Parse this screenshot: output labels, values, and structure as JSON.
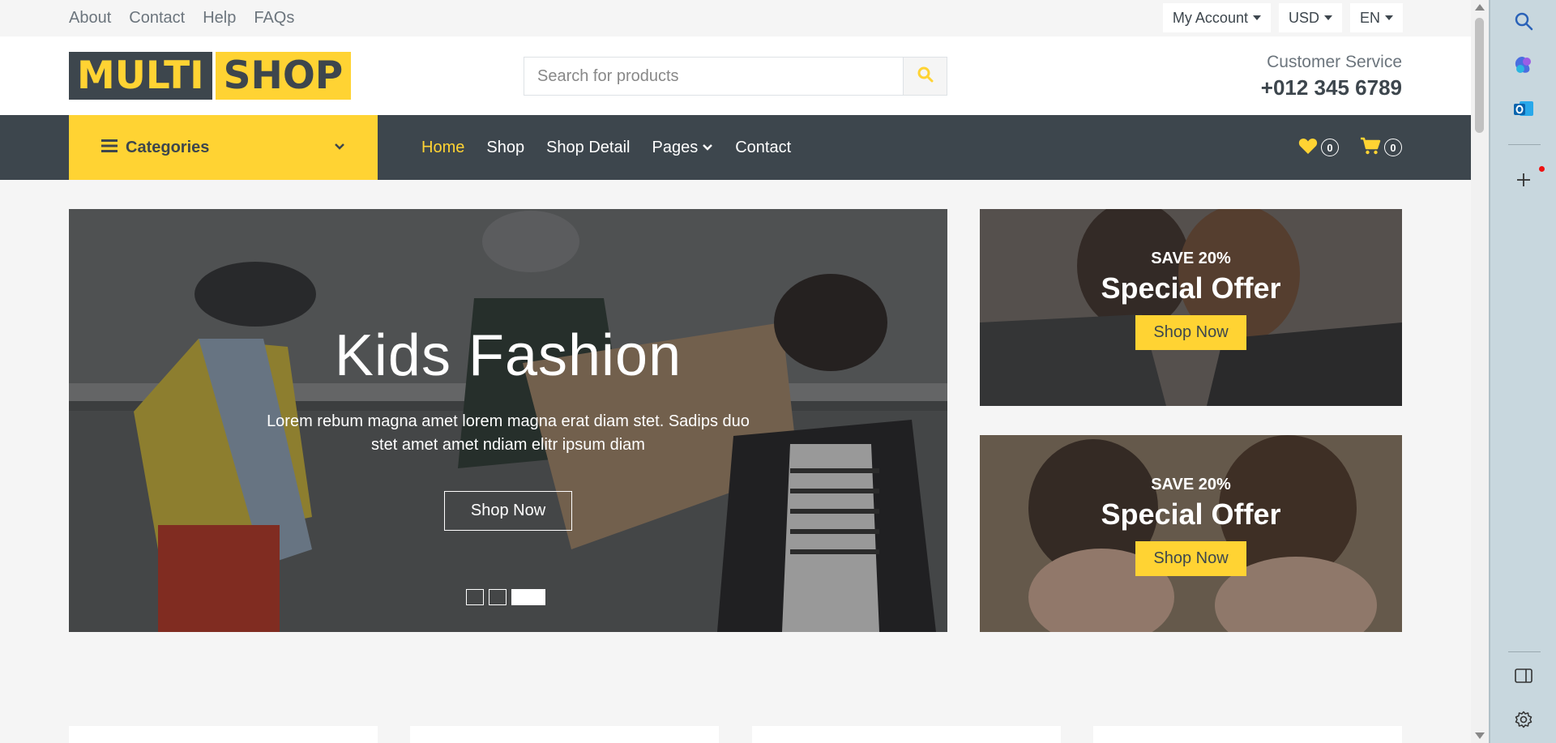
{
  "topbar": {
    "links": [
      "About",
      "Contact",
      "Help",
      "FAQs"
    ],
    "account_label": "My Account",
    "currency_label": "USD",
    "language_label": "EN"
  },
  "header": {
    "logo_part1": "MULTI",
    "logo_part2": "SHOP",
    "search_placeholder": "Search for products",
    "service_label": "Customer Service",
    "service_phone": "+012 345 6789"
  },
  "nav": {
    "categories_label": "Categories",
    "links": [
      "Home",
      "Shop",
      "Shop Detail",
      "Pages",
      "Contact"
    ],
    "active": "Home",
    "wishlist_count": "0",
    "cart_count": "0"
  },
  "hero": {
    "title": "Kids Fashion",
    "text": "Lorem rebum magna amet lorem magna erat diam stet. Sadips duo stet amet amet ndiam elitr ipsum diam",
    "button": "Shop Now",
    "slides": 3,
    "active_slide": 3
  },
  "offers": [
    {
      "save": "SAVE 20%",
      "title": "Special Offer",
      "button": "Shop Now"
    },
    {
      "save": "SAVE 20%",
      "title": "Special Offer",
      "button": "Shop Now"
    }
  ],
  "colors": {
    "accent": "#ffd333",
    "dark": "#3d464d",
    "muted": "#6c757d",
    "background": "#f5f5f5"
  },
  "icons": {
    "search": "search-icon",
    "categories": "bars-icon",
    "wishlist": "heart-icon",
    "cart": "cart-icon"
  }
}
